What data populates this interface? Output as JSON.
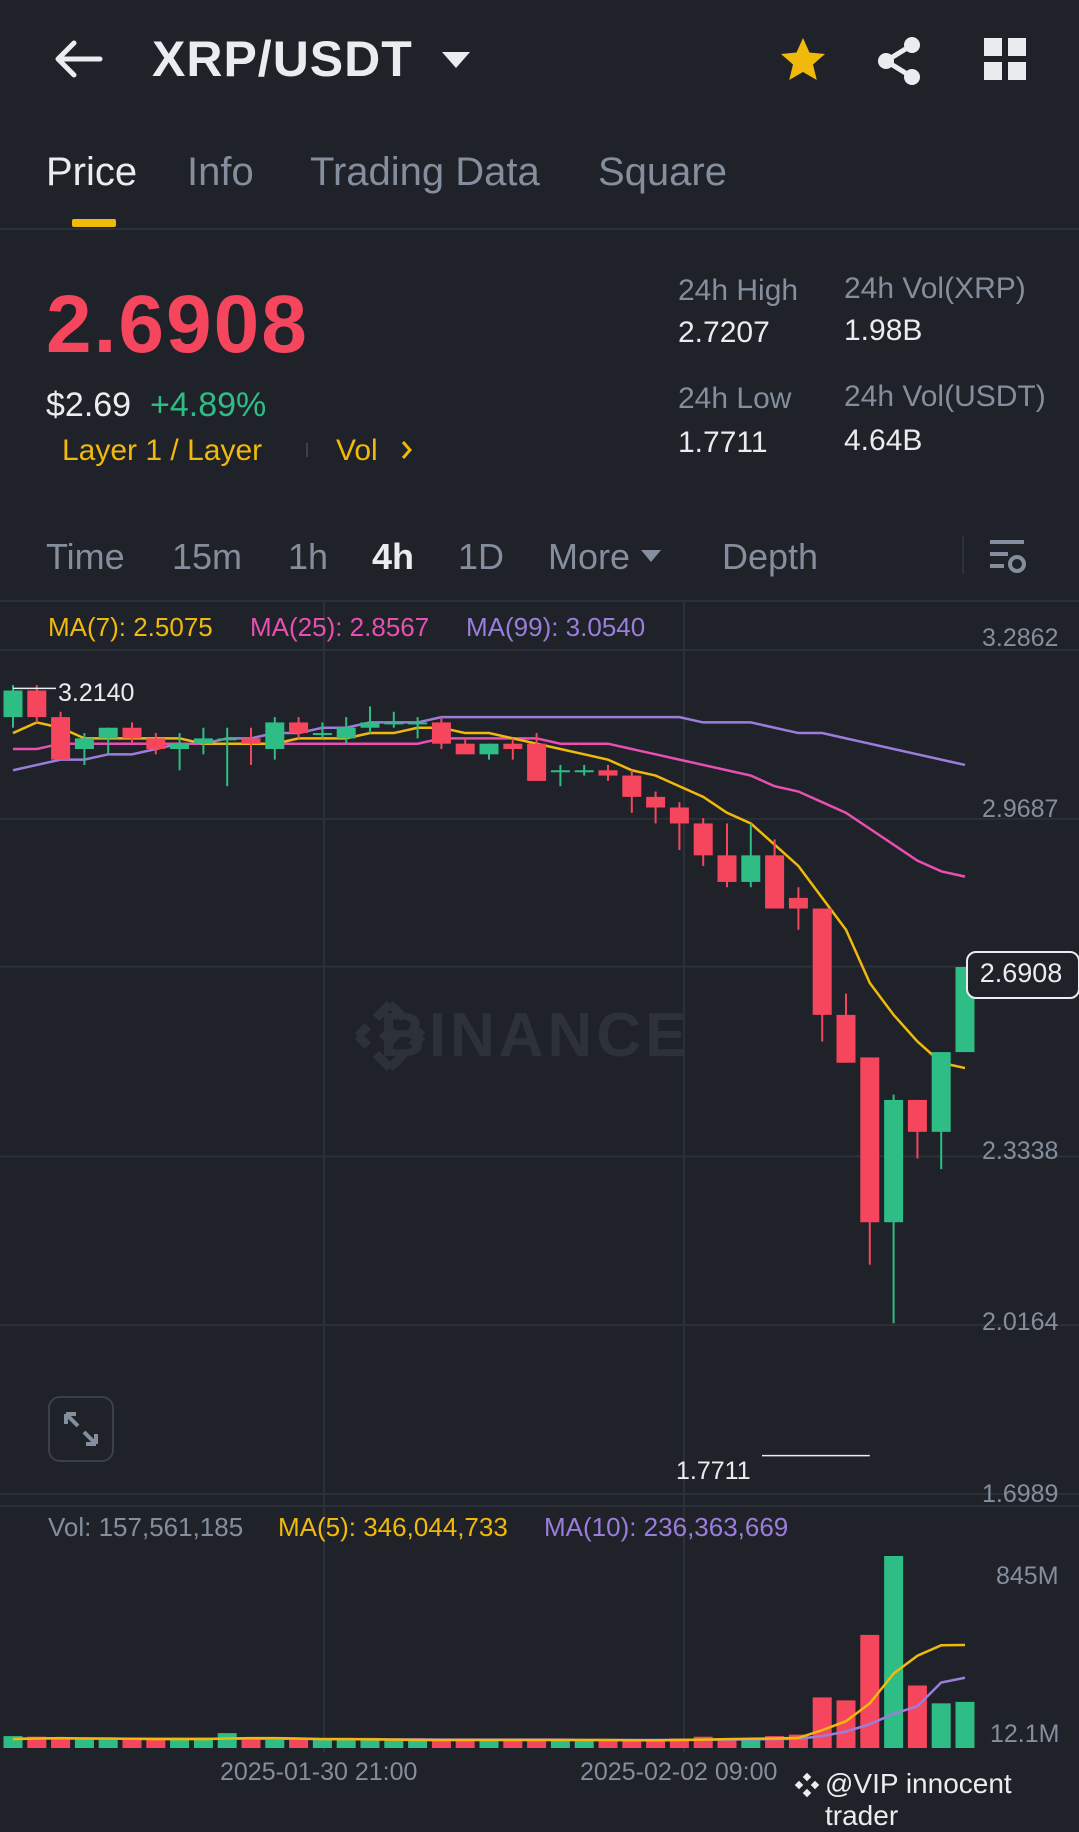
{
  "header": {
    "pair": "XRP/USDT",
    "icons": [
      "back-arrow-icon",
      "dropdown-caret-icon",
      "star-icon",
      "share-icon",
      "grid-icon"
    ],
    "star_color": "#f0b90b"
  },
  "tabs": [
    "Price",
    "Info",
    "Trading Data",
    "Square"
  ],
  "active_tab": "Price",
  "ticker": {
    "last_price": "2.6908",
    "usd_price": "$2.69",
    "change_pct": "+4.89%",
    "tags": "Layer 1 / Layer",
    "vol_link": "Vol",
    "high_label": "24h High",
    "high": "2.7207",
    "low_label": "24h Low",
    "low": "1.7711",
    "vol_base_label": "24h Vol(XRP)",
    "vol_base": "1.98B",
    "vol_quote_label": "24h Vol(USDT)",
    "vol_quote": "4.64B"
  },
  "intervals": [
    "Time",
    "15m",
    "1h",
    "4h",
    "1D",
    "More",
    "Depth"
  ],
  "active_interval": "4h",
  "colors": {
    "up": "#2ebd85",
    "down": "#f6465d",
    "ma7": "#f0b90b",
    "ma25": "#e84fb3",
    "ma99": "#9b7ddb",
    "accent": "#f0b90b"
  },
  "chart_data": {
    "type": "candlestick",
    "ma_labels": [
      "MA(7): 2.5075",
      "MA(25): 2.8567",
      "MA(99): 3.0540"
    ],
    "y_ticks": [
      "3.2862",
      "2.9687",
      "2.6908",
      "2.3338",
      "2.0164",
      "1.6989"
    ],
    "ylim": [
      1.6989,
      3.2862
    ],
    "y_tick_values": [
      3.2862,
      2.9687,
      2.3338,
      2.0164,
      1.6989
    ],
    "last_price": 2.6908,
    "high_marker": "3.2140",
    "high_marker_value": 3.214,
    "low_marker": "1.7711",
    "low_marker_value": 1.7711,
    "x_labels": [
      "2025-01-30 21:00",
      "2025-02-02 09:00"
    ],
    "candles": [
      [
        3.16,
        3.22,
        3.14,
        3.21
      ],
      [
        3.21,
        3.22,
        3.15,
        3.16
      ],
      [
        3.16,
        3.17,
        3.08,
        3.08
      ],
      [
        3.1,
        3.13,
        3.07,
        3.12
      ],
      [
        3.12,
        3.14,
        3.09,
        3.14
      ],
      [
        3.14,
        3.15,
        3.11,
        3.12
      ],
      [
        3.12,
        3.13,
        3.09,
        3.1
      ],
      [
        3.1,
        3.13,
        3.06,
        3.11
      ],
      [
        3.11,
        3.14,
        3.09,
        3.12
      ],
      [
        3.12,
        3.14,
        3.03,
        3.12
      ],
      [
        3.12,
        3.14,
        3.07,
        3.11
      ],
      [
        3.1,
        3.16,
        3.08,
        3.15
      ],
      [
        3.15,
        3.16,
        3.12,
        3.13
      ],
      [
        3.13,
        3.15,
        3.12,
        3.13
      ],
      [
        3.12,
        3.16,
        3.11,
        3.14
      ],
      [
        3.14,
        3.18,
        3.13,
        3.15
      ],
      [
        3.15,
        3.17,
        3.14,
        3.15
      ],
      [
        3.15,
        3.16,
        3.12,
        3.15
      ],
      [
        3.15,
        3.16,
        3.1,
        3.11
      ],
      [
        3.11,
        3.12,
        3.09,
        3.09
      ],
      [
        3.09,
        3.11,
        3.08,
        3.11
      ],
      [
        3.11,
        3.12,
        3.08,
        3.1
      ],
      [
        3.11,
        3.13,
        3.04,
        3.04
      ],
      [
        3.06,
        3.07,
        3.03,
        3.06
      ],
      [
        3.06,
        3.07,
        3.05,
        3.06
      ],
      [
        3.06,
        3.07,
        3.04,
        3.05
      ],
      [
        3.05,
        3.06,
        2.98,
        3.01
      ],
      [
        3.01,
        3.02,
        2.96,
        2.99
      ],
      [
        2.99,
        3.0,
        2.91,
        2.96
      ],
      [
        2.96,
        2.97,
        2.88,
        2.9
      ],
      [
        2.9,
        2.96,
        2.84,
        2.85
      ],
      [
        2.85,
        2.96,
        2.84,
        2.9
      ],
      [
        2.9,
        2.93,
        2.81,
        2.8
      ],
      [
        2.82,
        2.84,
        2.76,
        2.8
      ],
      [
        2.8,
        2.8,
        2.55,
        2.6
      ],
      [
        2.6,
        2.64,
        2.51,
        2.51
      ],
      [
        2.52,
        2.52,
        2.13,
        2.21
      ],
      [
        2.21,
        2.45,
        2.02,
        2.44
      ],
      [
        2.44,
        2.44,
        2.33,
        2.38
      ],
      [
        2.38,
        2.53,
        2.31,
        2.53
      ],
      [
        2.53,
        2.69,
        2.54,
        2.69
      ]
    ],
    "ma7": [
      3.13,
      3.15,
      3.14,
      3.12,
      3.12,
      3.12,
      3.12,
      3.12,
      3.11,
      3.11,
      3.11,
      3.11,
      3.12,
      3.12,
      3.12,
      3.13,
      3.13,
      3.14,
      3.14,
      3.13,
      3.13,
      3.12,
      3.11,
      3.1,
      3.09,
      3.08,
      3.06,
      3.05,
      3.03,
      3.01,
      2.98,
      2.96,
      2.92,
      2.88,
      2.82,
      2.76,
      2.66,
      2.6,
      2.55,
      2.51,
      2.5
    ],
    "ma25": [
      3.1,
      3.1,
      3.11,
      3.11,
      3.11,
      3.11,
      3.11,
      3.11,
      3.11,
      3.11,
      3.11,
      3.11,
      3.11,
      3.11,
      3.11,
      3.11,
      3.11,
      3.11,
      3.12,
      3.12,
      3.12,
      3.12,
      3.12,
      3.11,
      3.11,
      3.11,
      3.1,
      3.09,
      3.08,
      3.07,
      3.06,
      3.05,
      3.03,
      3.02,
      3.0,
      2.98,
      2.95,
      2.92,
      2.89,
      2.87,
      2.86
    ],
    "ma99": [
      3.06,
      3.07,
      3.08,
      3.08,
      3.09,
      3.09,
      3.1,
      3.11,
      3.11,
      3.12,
      3.12,
      3.13,
      3.13,
      3.14,
      3.14,
      3.15,
      3.15,
      3.15,
      3.16,
      3.16,
      3.16,
      3.16,
      3.16,
      3.16,
      3.16,
      3.16,
      3.16,
      3.16,
      3.16,
      3.15,
      3.15,
      3.15,
      3.14,
      3.13,
      3.13,
      3.12,
      3.11,
      3.1,
      3.09,
      3.08,
      3.07
    ],
    "volume": {
      "label": "Vol: 157,561,185",
      "ma5_label": "MA(5): 346,044,733",
      "ma10_label": "MA(10): 236,363,669",
      "y_ticks": [
        "845M",
        "12.1M"
      ],
      "values": [
        40,
        38,
        35,
        32,
        30,
        30,
        28,
        30,
        30,
        50,
        35,
        30,
        28,
        28,
        30,
        28,
        26,
        26,
        28,
        26,
        28,
        30,
        26,
        24,
        26,
        26,
        28,
        30,
        32,
        38,
        30,
        32,
        40,
        45,
        170,
        160,
        380,
        645,
        210,
        150,
        155
      ],
      "ma5": [
        30,
        32,
        33,
        32,
        32,
        31,
        30,
        30,
        30,
        32,
        33,
        33,
        32,
        30,
        30,
        29,
        28,
        27,
        27,
        27,
        27,
        27,
        27,
        27,
        27,
        27,
        26,
        26,
        27,
        28,
        30,
        31,
        32,
        34,
        60,
        90,
        150,
        250,
        310,
        345,
        346
      ],
      "ma10": [
        32,
        32,
        32,
        32,
        31,
        31,
        31,
        31,
        31,
        31,
        31,
        31,
        31,
        30,
        30,
        30,
        29,
        29,
        28,
        28,
        28,
        28,
        28,
        28,
        27,
        27,
        27,
        27,
        27,
        28,
        28,
        29,
        30,
        31,
        40,
        55,
        80,
        115,
        140,
        220,
        236
      ]
    }
  },
  "watermark": "BINANCE",
  "credit": "@VIP innocent trader"
}
